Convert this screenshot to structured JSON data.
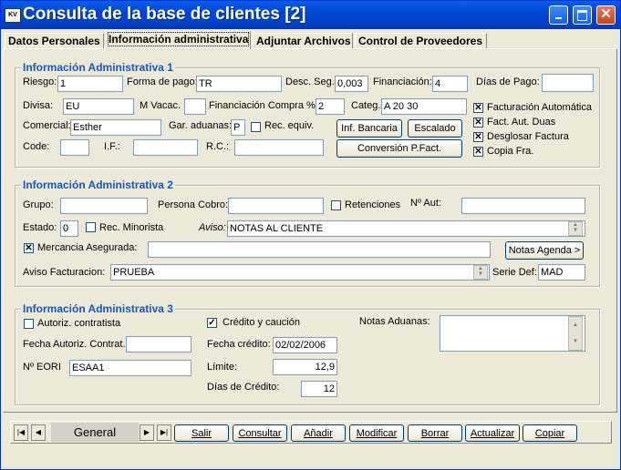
{
  "window": {
    "title": "Consulta de la base de clientes [2]",
    "icon_text": "KV"
  },
  "tabs": [
    "Datos Personales",
    "Información administrativa",
    "Adjuntar Archivos",
    "Control de Proveedores"
  ],
  "group1": {
    "title": "Información Administrativa 1",
    "riesgo_label": "Riesgo:",
    "riesgo": "1",
    "forma_pago_label": "Forma de pago:",
    "forma_pago": "TR",
    "desc_seg_label": "Desc. Seg.",
    "desc_seg": "0,003",
    "financiacion_label": "Financiación:",
    "financiacion": "4",
    "dias_pago_label": "Días de Pago:",
    "dias_pago": "",
    "divisa_label": "Divisa:",
    "divisa": "EU",
    "m_vacac_label": "M Vacac.",
    "m_vacac": "",
    "fin_compra_label": "Financiación Compra %:",
    "fin_compra": "2",
    "categ_label": "Categ.",
    "categ": "A 20 30",
    "comercial_label": "Comercial:",
    "comercial": "Esther",
    "gar_aduanas_label": "Gar. aduanas:",
    "gar_aduanas": "P",
    "rec_equiv_label": "Rec. equiv.",
    "code_label": "Code:",
    "code": "",
    "if_label": "I.F.:",
    "if": "",
    "rc_label": "R.C.:",
    "rc": "",
    "inf_bancaria_btn": "Inf. Bancaria",
    "escalado_btn": "Escalado",
    "conversion_btn": "Conversión P.Fact.",
    "checks": [
      {
        "label": "Facturación Automática",
        "checked": true
      },
      {
        "label": "Fact. Aut. Duas",
        "checked": true
      },
      {
        "label": "Desglosar Factura",
        "checked": true
      },
      {
        "label": "Copia Fra.",
        "checked": true
      }
    ]
  },
  "group2": {
    "title": "Información Administrativa 2",
    "grupo_label": "Grupo:",
    "grupo": "",
    "persona_cobro_label": "Persona Cobro:",
    "persona_cobro": "",
    "retenciones_label": "Retenciones",
    "n_aut_label": "Nº Aut:",
    "n_aut": "",
    "estado_label": "Estado:",
    "estado": "0",
    "rec_minorista_label": "Rec. Minorista",
    "aviso_label": "Aviso:",
    "aviso": "NOTAS AL CLIENTE",
    "mercancia_label": "Mercancia Asegurada:",
    "mercancia": "",
    "notas_agenda_btn": "Notas Agenda >",
    "aviso_fact_label": "Aviso Facturacion:",
    "aviso_fact": "PRUEBA",
    "serie_def_label": "Serie Def:",
    "serie_def": "MAD"
  },
  "group3": {
    "title": "Información Administrativa 3",
    "autoriz_label": "Autoriz. contratista",
    "fecha_autoriz_label": "Fecha Autoriz. Contrat.",
    "fecha_autoriz": "",
    "n_eori_label": "Nº EORI",
    "n_eori": "ESAA1",
    "credito_caucion_label": "Crédito y caución",
    "fecha_credito_label": "Fecha crédito:",
    "fecha_credito": "02/02/2006",
    "limite_label": "Límite:",
    "limite": "12,9",
    "dias_credito_label": "Días de Crédito:",
    "dias_credito": "12",
    "notas_aduanas_label": "Notas Aduanas:",
    "notas_aduanas": ""
  },
  "navbar": {
    "general": "General",
    "buttons": [
      "Salir",
      "Consultar",
      "Añadir",
      "Modificar",
      "Borrar",
      "Actualizar",
      "Copiar"
    ]
  }
}
